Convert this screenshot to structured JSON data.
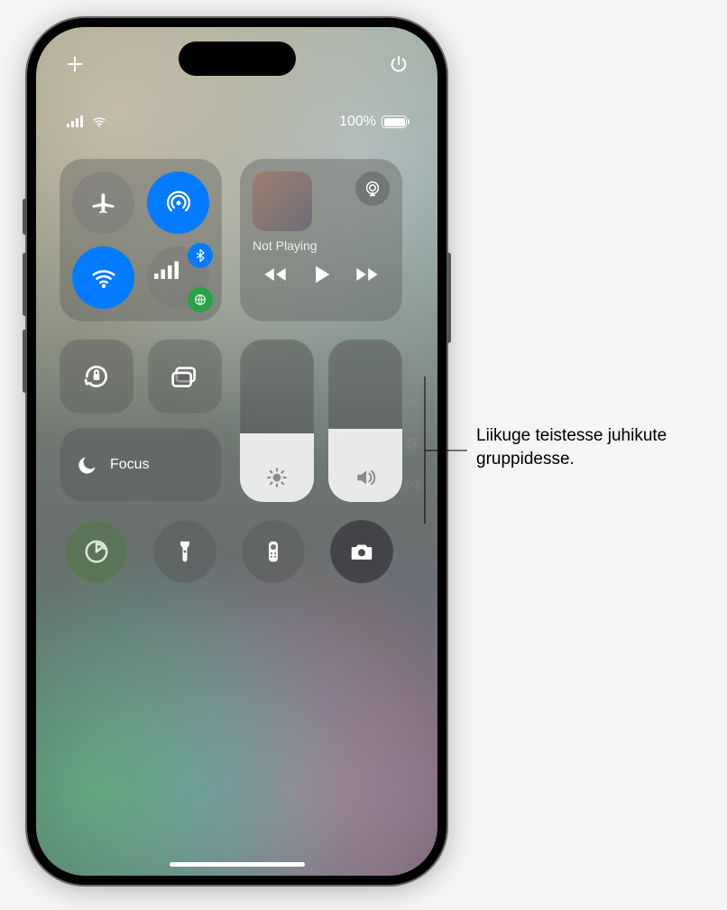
{
  "status": {
    "battery_pct_label": "100%",
    "battery_pct": 100
  },
  "top_icons": {
    "add": "plus-icon",
    "power": "power-icon"
  },
  "connectivity": {
    "airplane_on": false,
    "airdrop_on": true,
    "wifi_on": true,
    "cellular_on": false,
    "bluetooth_on": true
  },
  "media": {
    "status_text": "Not Playing"
  },
  "focus": {
    "label": "Focus"
  },
  "sliders": {
    "brightness_pct": 42,
    "volume_pct": 45
  },
  "bottom_row": [
    {
      "name": "timer-button",
      "icon": "timer-icon"
    },
    {
      "name": "flashlight-button",
      "icon": "flashlight-icon"
    },
    {
      "name": "remote-button",
      "icon": "apple-tv-remote-icon"
    },
    {
      "name": "camera-button",
      "icon": "camera-icon"
    }
  ],
  "page_indicators": [
    {
      "name": "favorites-page",
      "icon": "heart-icon",
      "active": true
    },
    {
      "name": "music-page",
      "icon": "music-note-icon",
      "active": false
    },
    {
      "name": "connectivity-page",
      "icon": "radio-waves-icon",
      "active": false
    }
  ],
  "callout": {
    "text": "Liikuge teistesse juhikute gruppidesse."
  }
}
